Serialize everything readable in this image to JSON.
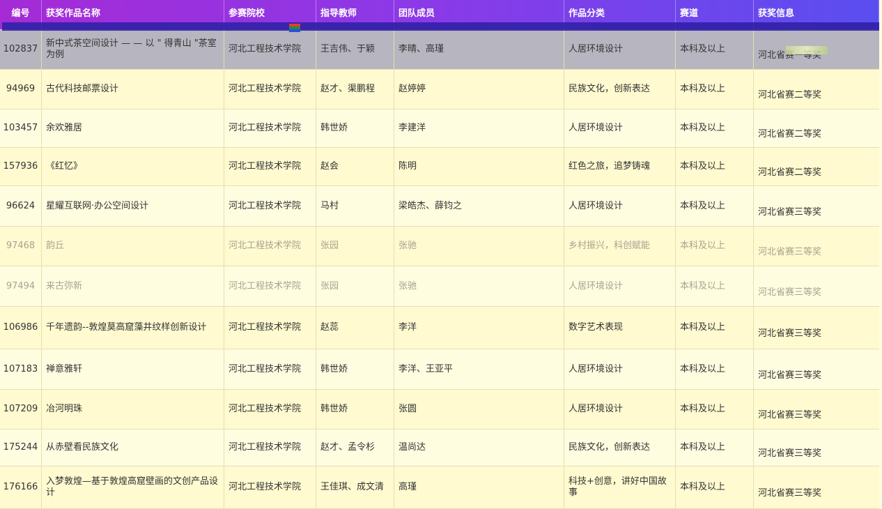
{
  "columns": [
    "编号",
    "获奖作品名称",
    "参赛院校",
    "指导教师",
    "团队成员",
    "作品分类",
    "赛道",
    "获奖信息"
  ],
  "rows": [
    {
      "id": "102837",
      "title": "新中式茶空间设计 — — 以 \" 得青山 \"茶室为例",
      "school": "河北工程技术学院",
      "advisor": "王吉伟、于颖",
      "members": "李晴、高瑾",
      "category": "人居环境设计",
      "track": "本科及以上",
      "award": "河北省赛一等奖"
    },
    {
      "id": "94969",
      "title": "古代科技邮票设计",
      "school": "河北工程技术学院",
      "advisor": "赵才、渠鹏程",
      "members": "赵婷婷",
      "category": "民族文化，创新表达",
      "track": "本科及以上",
      "award": "河北省赛二等奖"
    },
    {
      "id": "103457",
      "title": "余欢雅居",
      "school": "河北工程技术学院",
      "advisor": "韩世娇",
      "members": "李建洋",
      "category": "人居环境设计",
      "track": "本科及以上",
      "award": "河北省赛二等奖"
    },
    {
      "id": "157936",
      "title": "《红忆》",
      "school": "河北工程技术学院",
      "advisor": "赵会",
      "members": "陈明",
      "category": "红色之旅，追梦铸魂",
      "track": "本科及以上",
      "award": "河北省赛二等奖"
    },
    {
      "id": "96624",
      "title": "星耀互联网·办公空间设计",
      "school": "河北工程技术学院",
      "advisor": "马村",
      "members": "梁皓杰、薛钧之",
      "category": "人居环境设计",
      "track": "本科及以上",
      "award": "河北省赛三等奖"
    },
    {
      "id": "97468",
      "title": "韵丘",
      "school": "河北工程技术学院",
      "advisor": "张园",
      "members": "张驰",
      "category": "乡村振兴，科创赋能",
      "track": "本科及以上",
      "award": "河北省赛三等奖"
    },
    {
      "id": "97494",
      "title": "来古弥新",
      "school": "河北工程技术学院",
      "advisor": "张园",
      "members": "张驰",
      "category": "人居环境设计",
      "track": "本科及以上",
      "award": "河北省赛三等奖"
    },
    {
      "id": "106986",
      "title": "千年遗韵--敦煌莫高窟藻井纹样创新设计",
      "school": "河北工程技术学院",
      "advisor": "赵蕊",
      "members": "李洋",
      "category": "数字艺术表现",
      "track": "本科及以上",
      "award": "河北省赛三等奖"
    },
    {
      "id": "107183",
      "title": "禅意雅轩",
      "school": "河北工程技术学院",
      "advisor": "韩世娇",
      "members": "李洋、王亚平",
      "category": "人居环境设计",
      "track": "本科及以上",
      "award": "河北省赛三等奖"
    },
    {
      "id": "107209",
      "title": "冶河明珠",
      "school": "河北工程技术学院",
      "advisor": "韩世娇",
      "members": "张圆",
      "category": "人居环境设计",
      "track": "本科及以上",
      "award": "河北省赛三等奖"
    },
    {
      "id": "175244",
      "title": "从赤壁看民族文化",
      "school": "河北工程技术学院",
      "advisor": "赵才、孟令杉",
      "members": "温尚达",
      "category": "民族文化，创新表达",
      "track": "本科及以上",
      "award": "河北省赛三等奖"
    },
    {
      "id": "176166",
      "title": "入梦敦煌—基于敦煌高窟壁画的文创产品设计",
      "school": "河北工程技术学院",
      "advisor": "王佳琪、成文清",
      "members": "高瑾",
      "category": "科技+创意，讲好中国故事",
      "track": "本科及以上",
      "award": "河北省赛三等奖"
    }
  ]
}
